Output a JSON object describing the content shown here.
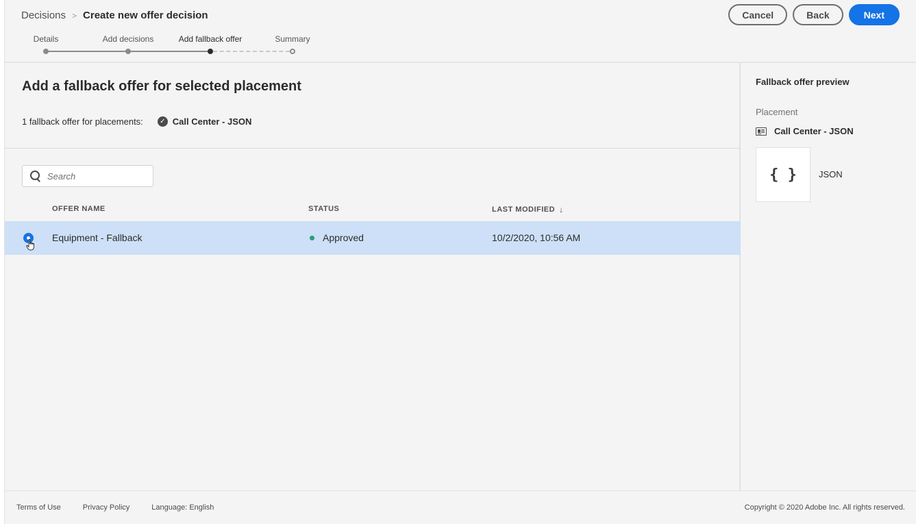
{
  "header": {
    "breadcrumb_root": "Decisions",
    "breadcrumb_separator": ">",
    "breadcrumb_current": "Create new offer decision",
    "cancel_label": "Cancel",
    "back_label": "Back",
    "next_label": "Next"
  },
  "stepper": {
    "steps": [
      {
        "label": "Details",
        "state": "completed"
      },
      {
        "label": "Add decisions",
        "state": "completed"
      },
      {
        "label": "Add fallback offer",
        "state": "current"
      },
      {
        "label": "Summary",
        "state": "upcoming"
      }
    ]
  },
  "main": {
    "title": "Add a fallback offer for selected placement",
    "placement_count_text": "1 fallback offer for placements:",
    "placement_name": "Call Center - JSON",
    "search": {
      "placeholder": "Search",
      "value": ""
    },
    "columns": {
      "offer_name": "OFFER NAME",
      "status": "STATUS",
      "last_modified": "LAST MODIFIED",
      "sort_icon": "arrow-down-icon"
    },
    "rows": [
      {
        "selected": true,
        "offer_name": "Equipment - Fallback",
        "status": "Approved",
        "status_color": "#2d9d78",
        "last_modified": "10/2/2020, 10:56 AM"
      }
    ]
  },
  "panel": {
    "title": "Fallback offer preview",
    "placement_label": "Placement",
    "placement_name": "Call Center - JSON",
    "preview_glyph": "{ }",
    "preview_label": "JSON"
  },
  "footer": {
    "terms": "Terms of Use",
    "privacy": "Privacy Policy",
    "language_label": "Language:",
    "language_value": "English",
    "copyright": "Copyright © 2020 Adobe Inc. All rights reserved."
  },
  "colors": {
    "accent": "#1473e6",
    "selected_row": "#cde0f7",
    "approved": "#2d9d78"
  }
}
